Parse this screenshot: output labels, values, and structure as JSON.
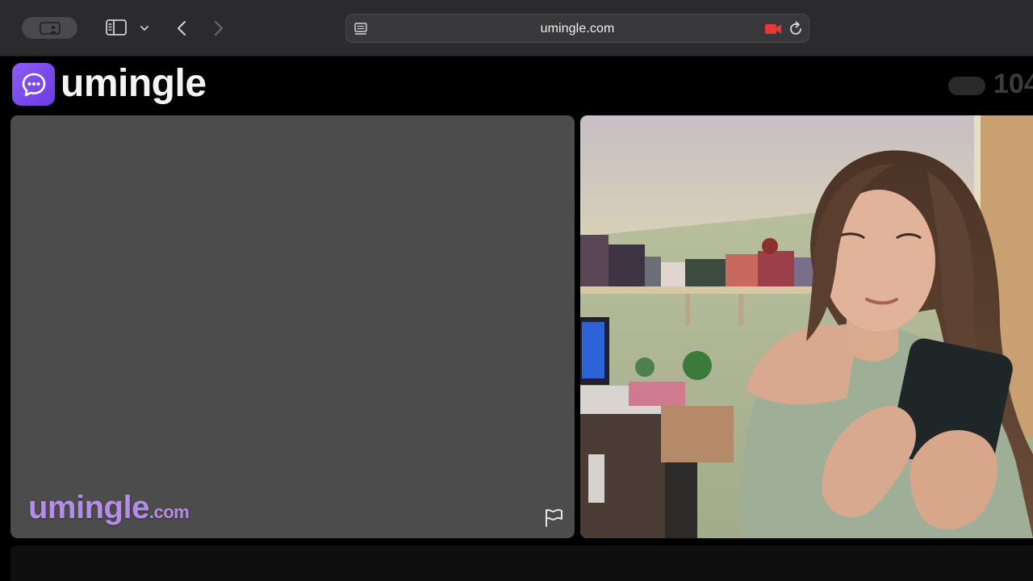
{
  "browser": {
    "url": "umingle.com",
    "icons": {
      "profile": "profile-switcher-icon",
      "sidebar": "sidebar-icon",
      "tab_menu": "chevron-down-icon",
      "back": "back-icon",
      "forward": "forward-icon",
      "page": "page-menu-icon",
      "camera": "camera-in-use-icon",
      "reload": "reload-icon"
    },
    "colors": {
      "toolbar": "#2b2b2d",
      "address_bar": "#38383a",
      "camera_indicator": "#e5383b"
    }
  },
  "site": {
    "logo_text": "umingle",
    "online_count": "104",
    "colors": {
      "brand": "#7c4dee",
      "watermark": "#b58de8"
    }
  },
  "stranger_video": {
    "watermark_name": "umingle",
    "watermark_suffix": ".com",
    "report_icon": "flag-icon"
  },
  "self_video": {
    "description_icon": "webcam-feed"
  }
}
